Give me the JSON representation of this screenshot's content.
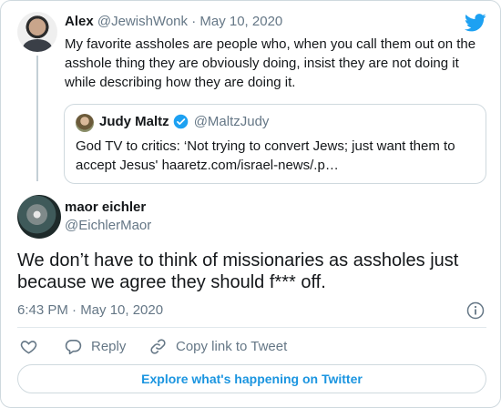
{
  "parent_tweet": {
    "name": "Alex",
    "handle": "@JewishWonk",
    "separator": "·",
    "date": "May 10, 2020",
    "text": "My favorite assholes are people who, when you call them out on the asshole thing they are obviously doing, insist they are not doing it while describing how they are doing it."
  },
  "quoted_tweet": {
    "name": "Judy Maltz",
    "handle": "@MaltzJudy",
    "text": "God TV to critics: ‘Not trying to convert Jews; just want them to accept Jesus' haaretz.com/israel-news/.p…"
  },
  "main_tweet": {
    "name": "maor eichler",
    "handle": "@EichlerMaor",
    "text": "We don’t have to think of missionaries as assholes just because we agree they should f*** off.",
    "time": "6:43 PM · May 10, 2020"
  },
  "actions": {
    "like_icon": "heart-icon",
    "reply_label": "Reply",
    "copy_link_label": "Copy link to Tweet"
  },
  "explore_label": "Explore what's happening on Twitter",
  "colors": {
    "brand": "#1da1f2",
    "link": "#1b95e0",
    "muted": "#657786",
    "border": "#cfd9de"
  }
}
